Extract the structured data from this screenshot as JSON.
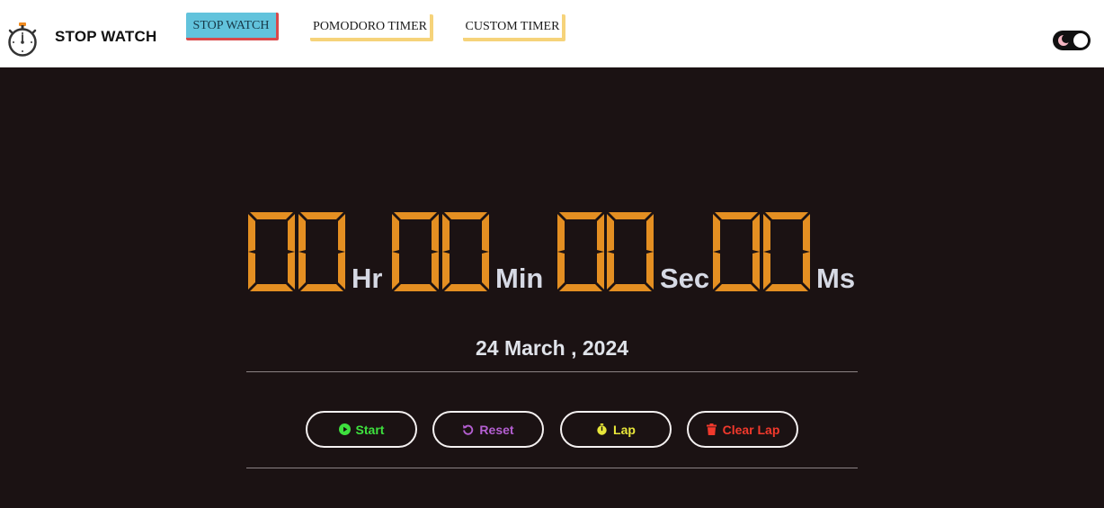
{
  "header": {
    "brand": "STOP WATCH",
    "logo_icon": "stopwatch-icon",
    "tabs": [
      {
        "label": "STOP WATCH",
        "active": true
      },
      {
        "label": "POMODORO TIMER",
        "active": false
      },
      {
        "label": "CUSTOM TIMER",
        "active": false
      }
    ],
    "theme_toggle_icon": "moon-icon"
  },
  "clock": {
    "hours": "00",
    "minutes": "00",
    "seconds": "00",
    "milliseconds": "00",
    "units": {
      "hours": "Hr",
      "minutes": "Min",
      "seconds": "Sec",
      "milliseconds": "Ms"
    }
  },
  "date": "24 March , 2024",
  "controls": {
    "start": {
      "label": "Start",
      "icon": "play-circle-icon",
      "color": "#3ee03e"
    },
    "reset": {
      "label": "Reset",
      "icon": "undo-icon",
      "color": "#b45fd1"
    },
    "lap": {
      "label": "Lap",
      "icon": "stopwatch-icon",
      "color": "#e8e63a"
    },
    "clear_lap": {
      "label": "Clear Lap",
      "icon": "trash-icon",
      "color": "#f2392c"
    }
  },
  "colors": {
    "background": "#1b1213",
    "navbar": "#ffffff",
    "digits": "#e48f22",
    "active_tab": "#62c3dc",
    "tab_accent": "#f6d37a"
  }
}
